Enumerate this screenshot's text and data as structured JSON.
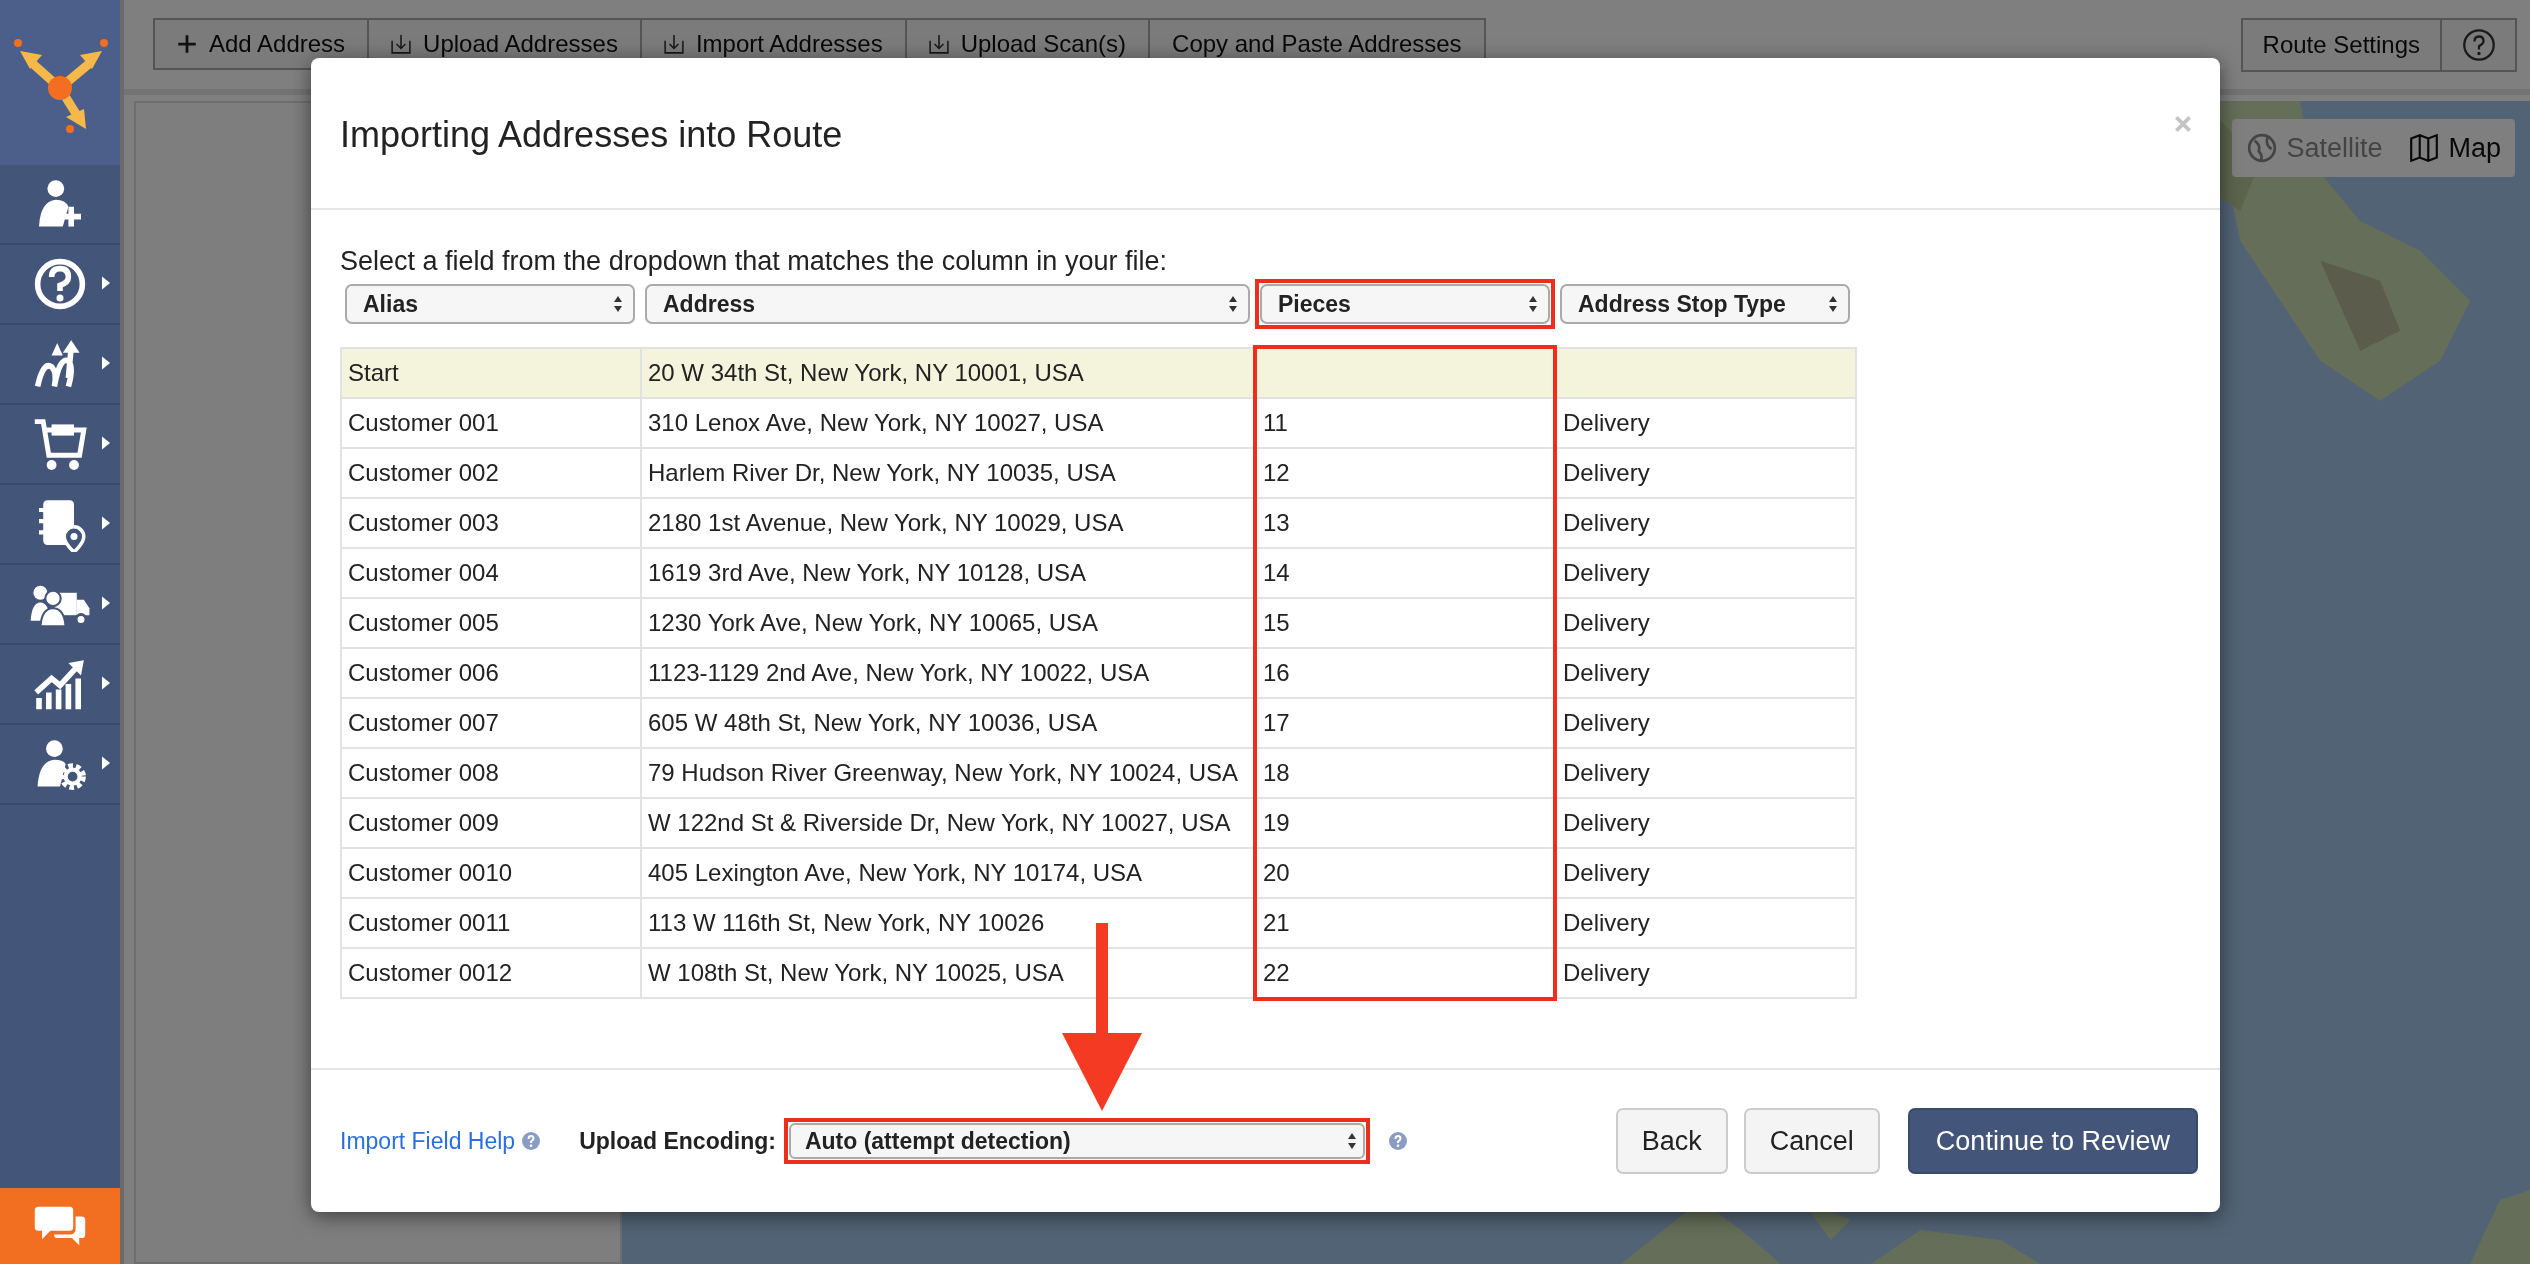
{
  "sidebar": {
    "items": [
      {
        "submenu": false
      },
      {
        "submenu": true
      },
      {
        "submenu": true
      },
      {
        "submenu": true
      },
      {
        "submenu": true
      },
      {
        "submenu": true
      },
      {
        "submenu": true
      },
      {
        "submenu": true
      }
    ]
  },
  "toolbar": [
    {
      "label": "Add Address",
      "kind": "add"
    },
    {
      "label": "Upload Addresses",
      "kind": "upload"
    },
    {
      "label": "Import Addresses",
      "kind": "upload"
    },
    {
      "label": "Upload Scan(s)",
      "kind": "upload"
    },
    {
      "label": "Copy and Paste Addresses",
      "kind": "plain"
    }
  ],
  "route_settings": {
    "label": "Route Settings"
  },
  "map_toggle": [
    {
      "label": "Satellite",
      "selected": false
    },
    {
      "label": "Map",
      "selected": true
    }
  ],
  "dialog": {
    "title": "Importing Addresses into Route",
    "instruction": "Select a field from the dropdown that matches the column in your file:",
    "columns": [
      {
        "label": "Alias",
        "highlighted": false
      },
      {
        "label": "Address",
        "highlighted": false
      },
      {
        "label": "Pieces",
        "highlighted": true
      },
      {
        "label": "Address Stop Type",
        "highlighted": false
      }
    ],
    "rows": [
      {
        "kind": "depot",
        "alias": "Start",
        "address": "20 W 34th St, New York, NY 10001, USA"
      },
      {
        "kind": "stop",
        "alias": "Customer 001",
        "address": "310 Lenox Ave, New York, NY 10027, USA",
        "pieces": "11",
        "stop_type": "Delivery"
      },
      {
        "kind": "stop",
        "alias": "Customer 002",
        "address": "Harlem River Dr, New York, NY 10035, USA",
        "pieces": "12",
        "stop_type": "Delivery"
      },
      {
        "kind": "stop",
        "alias": "Customer 003",
        "address": "2180 1st Avenue, New York, NY 10029, USA",
        "pieces": "13",
        "stop_type": "Delivery"
      },
      {
        "kind": "stop",
        "alias": "Customer 004",
        "address": "1619 3rd Ave, New York, NY 10128, USA",
        "pieces": "14",
        "stop_type": "Delivery"
      },
      {
        "kind": "stop",
        "alias": "Customer 005",
        "address": "1230 York Ave, New York, NY 10065, USA",
        "pieces": "15",
        "stop_type": "Delivery"
      },
      {
        "kind": "stop",
        "alias": "Customer 006",
        "address": "1123-1129 2nd Ave, New York, NY 10022, USA",
        "pieces": "16",
        "stop_type": "Delivery"
      },
      {
        "kind": "stop",
        "alias": "Customer 007",
        "address": "605 W 48th St, New York, NY 10036, USA",
        "pieces": "17",
        "stop_type": "Delivery"
      },
      {
        "kind": "stop",
        "alias": "Customer 008",
        "address": "79 Hudson River Greenway, New York, NY 10024, USA",
        "pieces": "18",
        "stop_type": "Delivery"
      },
      {
        "kind": "stop",
        "alias": "Customer 009",
        "address": "W 122nd St & Riverside Dr, New York, NY 10027, USA",
        "pieces": "19",
        "stop_type": "Delivery"
      },
      {
        "kind": "stop",
        "alias": "Customer 0010",
        "address": "405 Lexington Ave, New York, NY 10174, USA",
        "pieces": "20",
        "stop_type": "Delivery"
      },
      {
        "kind": "stop",
        "alias": "Customer 0011",
        "address": "113 W 116th St, New York, NY 10026",
        "pieces": "21",
        "stop_type": "Delivery"
      },
      {
        "kind": "stop",
        "alias": "Customer 0012",
        "address": "W 108th St, New York, NY 10025, USA",
        "pieces": "22",
        "stop_type": "Delivery"
      }
    ],
    "help_link": "Import Field Help",
    "encoding": {
      "label": "Upload Encoding:",
      "value": "Auto (attempt detection)",
      "highlighted": true
    },
    "buttons": [
      {
        "label": "Back",
        "kind": "default"
      },
      {
        "label": "Cancel",
        "kind": "default"
      },
      {
        "label": "Continue to Review",
        "kind": "primary"
      }
    ]
  }
}
